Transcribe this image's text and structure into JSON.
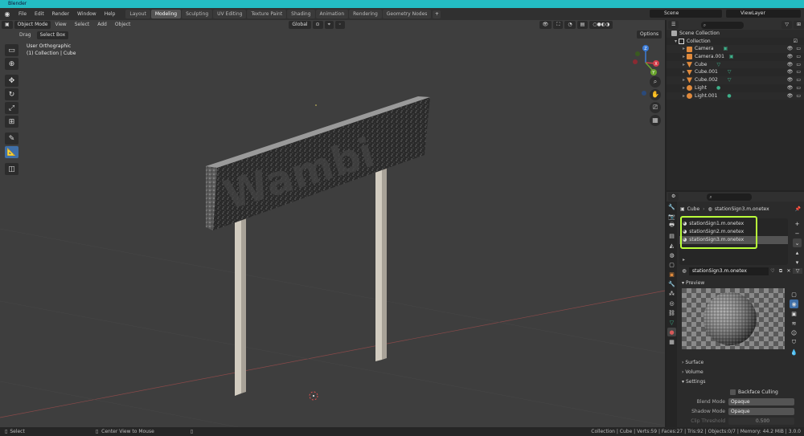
{
  "app": {
    "title": "Blender"
  },
  "menu": [
    "File",
    "Edit",
    "Render",
    "Window",
    "Help"
  ],
  "workspaces": {
    "tabs": [
      "Layout",
      "Modeling",
      "Sculpting",
      "UV Editing",
      "Texture Paint",
      "Shading",
      "Animation",
      "Rendering",
      "Geometry Nodes"
    ],
    "active": "Modeling",
    "add_label": "+"
  },
  "topright": {
    "scene": "Scene",
    "view_layer": "ViewLayer"
  },
  "viewport": {
    "mode": "Object Mode",
    "menus": [
      "View",
      "Select",
      "Add",
      "Object"
    ],
    "transform_orientation": "Global",
    "drag_label": "Drag",
    "select_tool": "Select Box",
    "options_label": "Options",
    "view_name": "User Orthographic",
    "collection_path": "(1) Collection | Cube",
    "sign_text": "Wambi",
    "gizmo_axes": {
      "x": "X",
      "y": "Y",
      "z": "Z"
    },
    "colors": {
      "bg": "#3e3e3e",
      "axis_red": "#a94545",
      "axis_green": "#6b9b3a",
      "panel": "#1f1f1f",
      "post": "#c9c2b6"
    }
  },
  "outliner": {
    "search_placeholder": "",
    "root": "Scene Collection",
    "collection": "Collection",
    "items": [
      {
        "name": "Camera",
        "type": "camera"
      },
      {
        "name": "Camera.001",
        "type": "camera"
      },
      {
        "name": "Cube",
        "type": "mesh"
      },
      {
        "name": "Cube.001",
        "type": "mesh"
      },
      {
        "name": "Cube.002",
        "type": "mesh"
      },
      {
        "name": "Light",
        "type": "light"
      },
      {
        "name": "Light.001",
        "type": "light"
      }
    ]
  },
  "properties": {
    "breadcrumb_object": "Cube",
    "breadcrumb_material": "stationSign3.m.onetex",
    "material_slots": [
      "stationSign1.m.onetex",
      "stationSign2.m.onetex",
      "stationSign3.m.onetex"
    ],
    "selected_slot_index": 2,
    "material_name": "stationSign3.m.onetex",
    "sections": {
      "preview": "Preview",
      "surface": "Surface",
      "volume": "Volume",
      "settings": "Settings"
    },
    "backface_culling": "Backface Culling",
    "blend_mode_label": "Blend Mode",
    "blend_mode_value": "Opaque",
    "shadow_mode_label": "Shadow Mode",
    "shadow_mode_value": "Opaque",
    "clip_threshold_label": "Clip Threshold",
    "clip_threshold_value": "0.500",
    "highlight_color": "#b9ff3a"
  },
  "statusbar": {
    "left_action": "Select",
    "middle_action": "Center View to Mouse",
    "stats": "Collection | Cube | Verts:59 | Faces:27 | Tris:92 | Objects:0/7 | Memory: 44.2 MiB | 3.0.0"
  }
}
